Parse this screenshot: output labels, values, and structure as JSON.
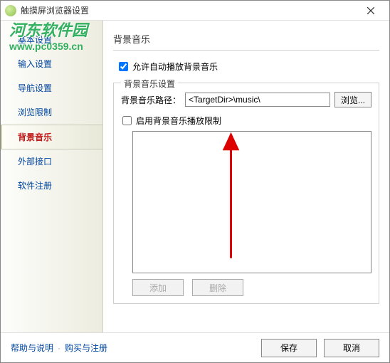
{
  "window": {
    "title": "触摸屏浏览器设置"
  },
  "watermark": {
    "cn": "河东软件园",
    "url": "www.pc0359.cn"
  },
  "sidebar": {
    "items": [
      {
        "label": "基本设置"
      },
      {
        "label": "输入设置"
      },
      {
        "label": "导航设置"
      },
      {
        "label": "浏览限制"
      },
      {
        "label": "背景音乐"
      },
      {
        "label": "外部接口"
      },
      {
        "label": "软件注册"
      }
    ],
    "active_index": 4
  },
  "main": {
    "title": "背景音乐",
    "allow_autoplay_label": "允许自动播放背景音乐",
    "fieldset_legend": "背景音乐设置",
    "path_label": "背景音乐路径：",
    "path_value": "<TargetDir>\\music\\",
    "browse_label": "浏览...",
    "enable_limit_label": "启用背景音乐播放限制",
    "add_label": "添加",
    "delete_label": "删除"
  },
  "footer": {
    "help_label": "帮助与说明",
    "separator": "·",
    "buy_label": "购买与注册",
    "save_label": "保存",
    "cancel_label": "取消"
  }
}
